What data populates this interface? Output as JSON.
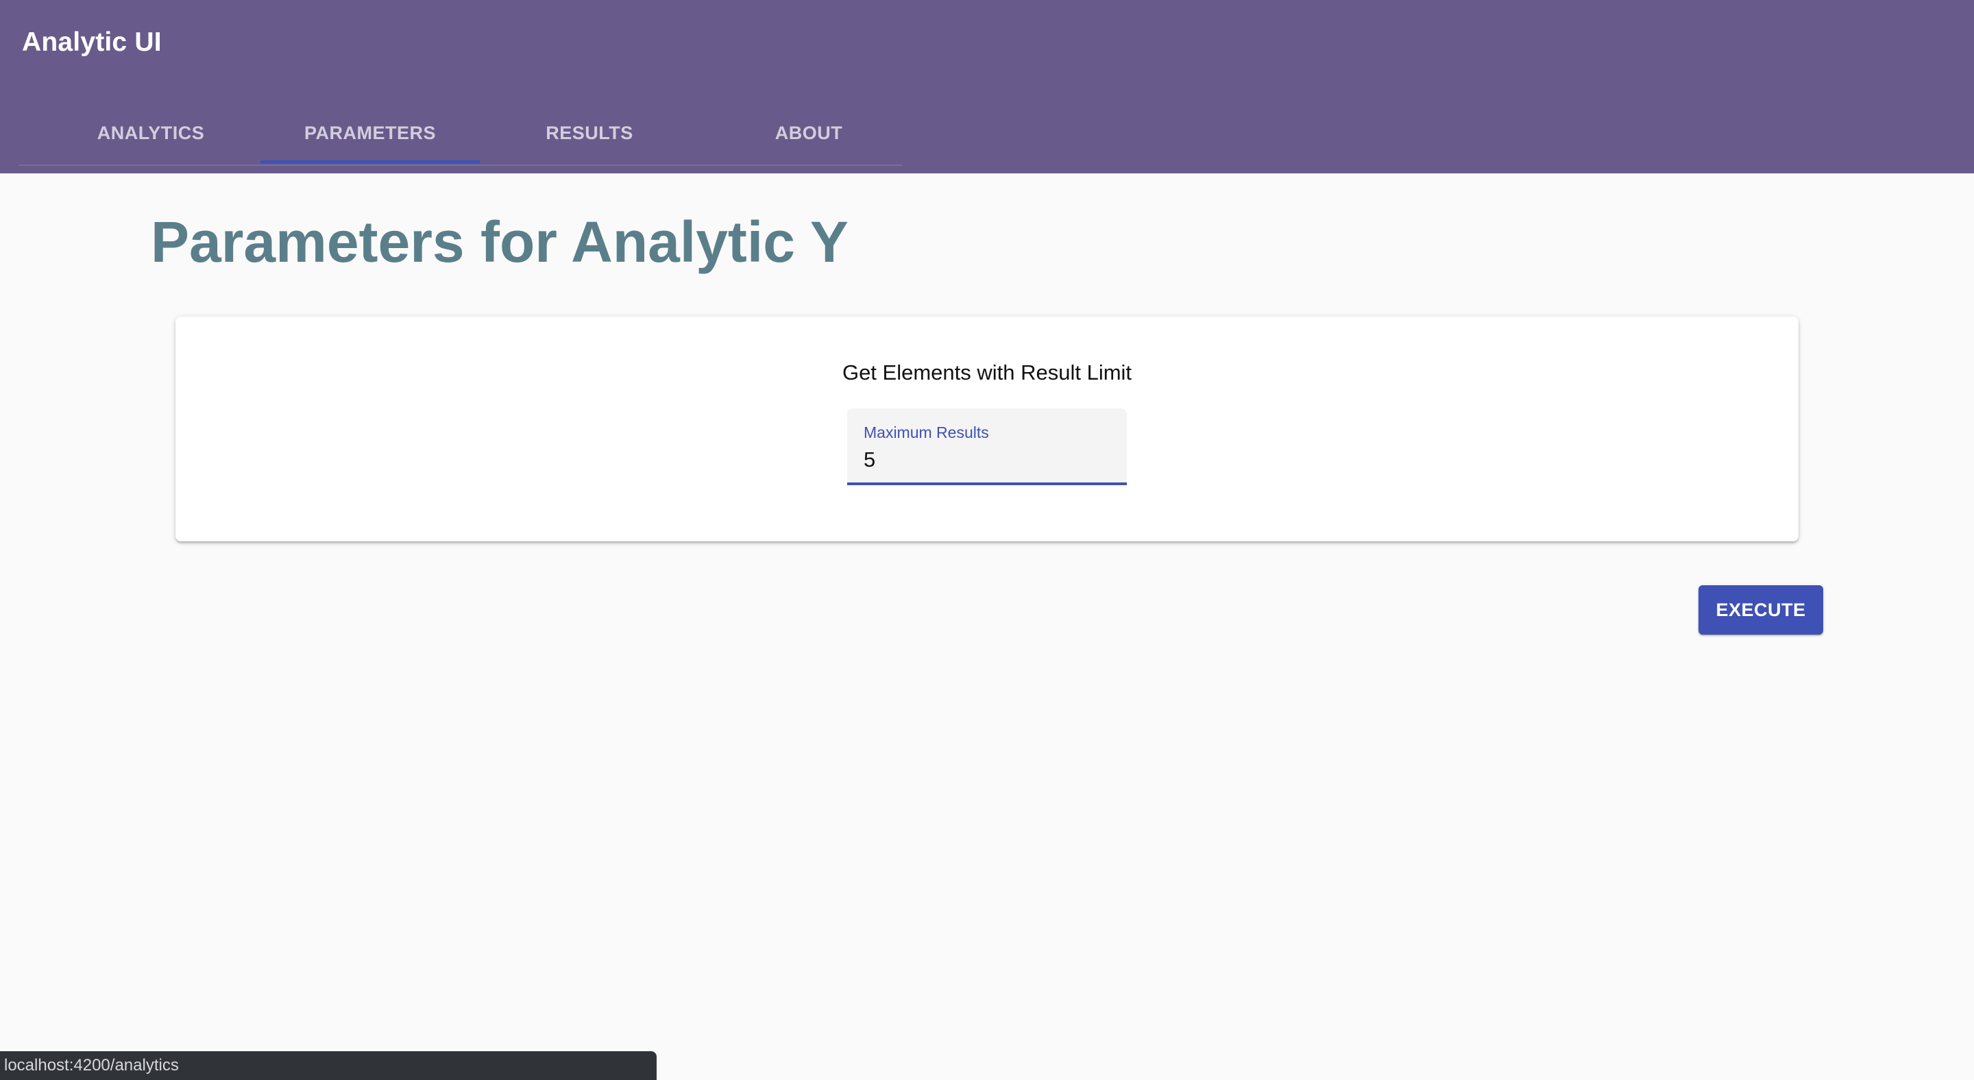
{
  "header": {
    "app_title": "Analytic UI",
    "tabs": [
      {
        "label": "ANALYTICS",
        "active": false
      },
      {
        "label": "PARAMETERS",
        "active": true
      },
      {
        "label": "RESULTS",
        "active": false
      },
      {
        "label": "ABOUT",
        "active": false
      }
    ]
  },
  "main": {
    "page_title": "Parameters for Analytic Y",
    "card": {
      "heading": "Get Elements with Result Limit",
      "field": {
        "label": "Maximum Results",
        "value": "5"
      }
    },
    "execute_label": "EXECUTE"
  },
  "status_bar": {
    "url": "localhost:4200/analytics"
  },
  "colors": {
    "toolbar": "#685b8b",
    "primary": "#3f51b5",
    "page_title": "#5a7f8a",
    "background": "#fafafa"
  }
}
